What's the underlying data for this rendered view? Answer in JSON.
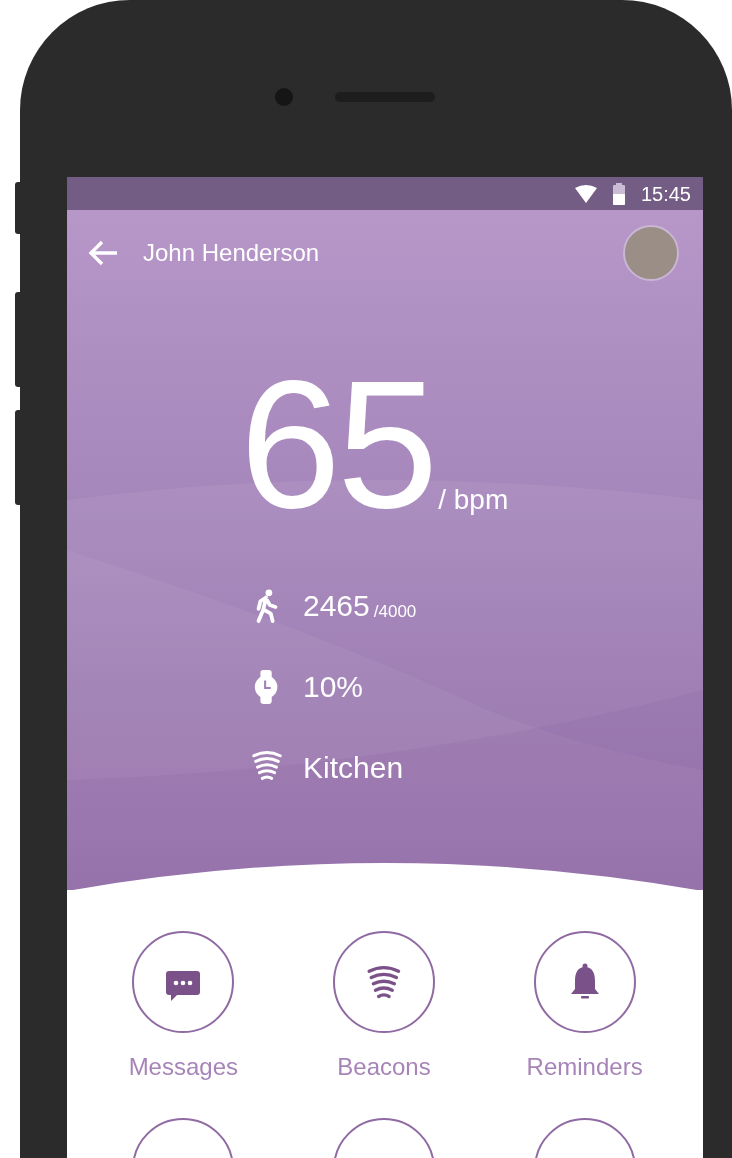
{
  "status_bar": {
    "time": "15:45"
  },
  "header": {
    "title": "John Henderson"
  },
  "heart_rate": {
    "value": "65",
    "unit": "/ bpm"
  },
  "stats": [
    {
      "kind": "steps",
      "value": "2465",
      "goal": "/4000"
    },
    {
      "kind": "watch",
      "value": "10%"
    },
    {
      "kind": "beacon",
      "value": "Kitchen"
    }
  ],
  "actions": [
    {
      "kind": "messages",
      "label": "Messages"
    },
    {
      "kind": "beacon",
      "label": "Beacons"
    },
    {
      "kind": "bell",
      "label": "Reminders"
    }
  ]
}
